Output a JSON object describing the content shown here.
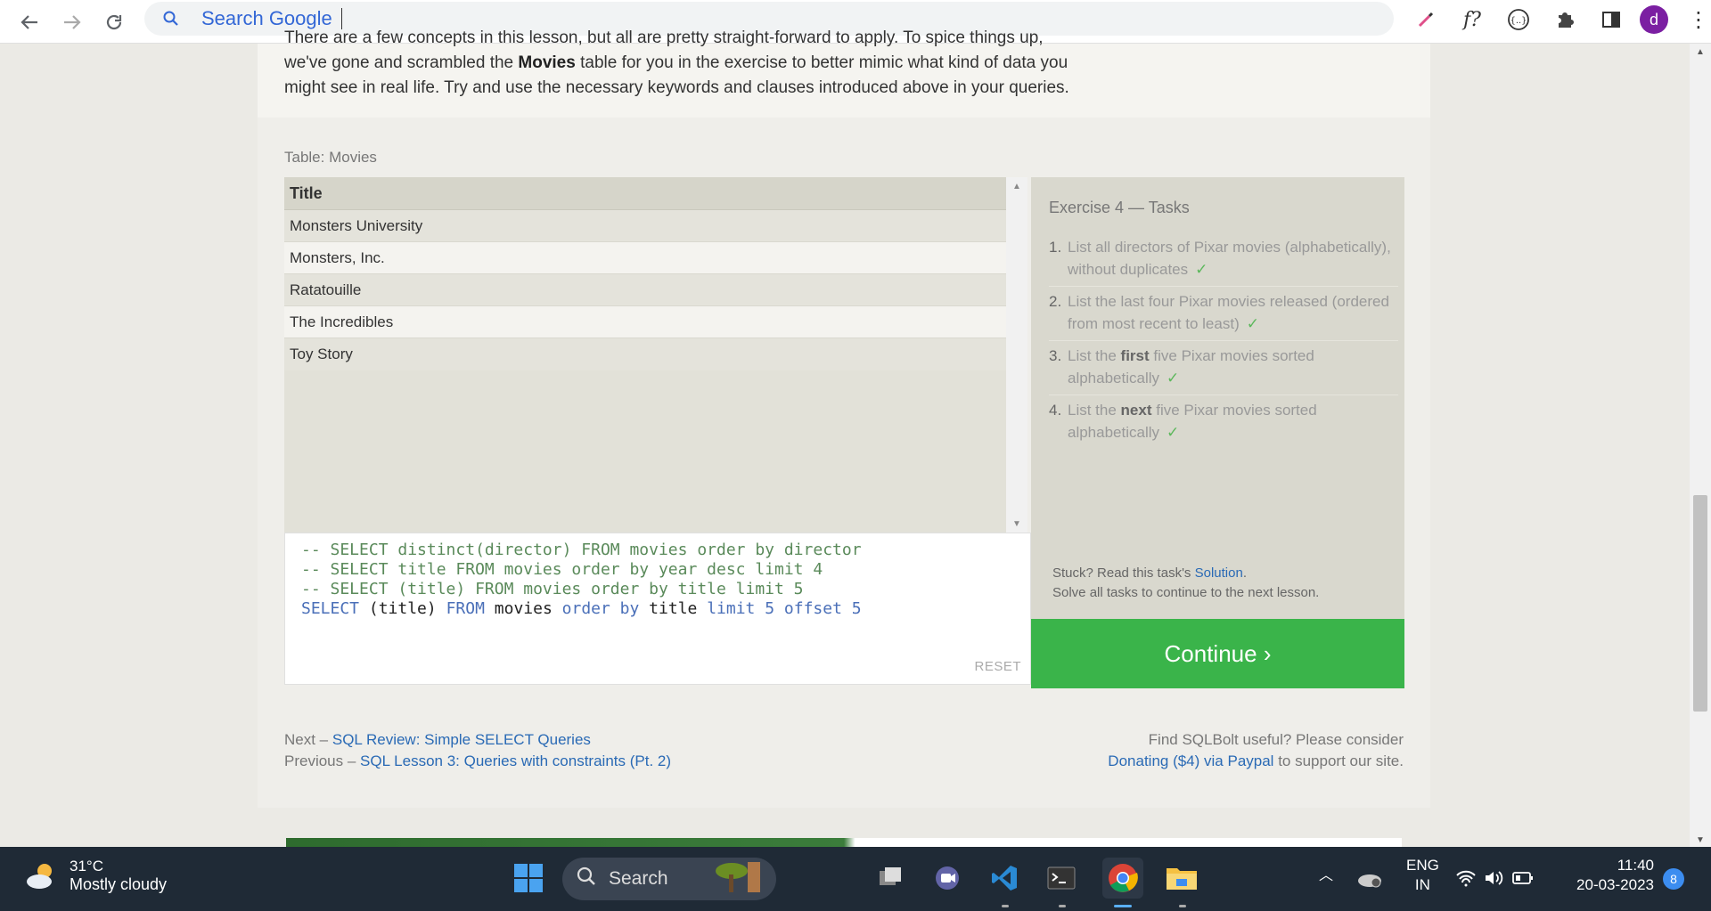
{
  "browser": {
    "omnibox_text": "Search Google",
    "avatar_letter": "d"
  },
  "intro": {
    "line0": "There are a few concepts in this lesson, but all are pretty straight-forward to apply. To spice things up,",
    "line1_pre": "we've gone and scrambled the ",
    "line1_bold": "Movies",
    "line1_post": " table for you in the exercise to better mimic what kind of data you",
    "line2": "might see in real life. Try and use the necessary keywords and clauses introduced above in your queries."
  },
  "table": {
    "label": "Table: Movies",
    "header": "Title",
    "rows": [
      "Monsters University",
      "Monsters, Inc.",
      "Ratatouille",
      "The Incredibles",
      "Toy Story"
    ]
  },
  "editor": {
    "comment1": "-- SELECT distinct(director) FROM movies order by director",
    "comment2": "-- SELECT title FROM movies order by year desc limit 4",
    "comment3": "-- SELECT (title) FROM movies order by title limit 5",
    "active": {
      "kw_select": "SELECT",
      "t_title": " (title) ",
      "kw_from": "FROM",
      "t_movies": " movies ",
      "kw_order": "order by",
      "t_title2": " title ",
      "kw_limit": "limit",
      "n5": " 5 ",
      "kw_offset": "offset",
      "n5b": " 5"
    },
    "reset_label": "RESET"
  },
  "tasks": {
    "heading": "Exercise 4 — Tasks",
    "items": [
      {
        "num": "1.",
        "pre": "List all directors of Pixar movies (alphabetically), without duplicates",
        "bold": "",
        "post": "",
        "check": "✓"
      },
      {
        "num": "2.",
        "pre": "List the last four Pixar movies released (ordered from most recent to least)",
        "bold": "",
        "post": "",
        "check": "✓"
      },
      {
        "num": "3.",
        "pre": "List the ",
        "bold": "first",
        "post": " five Pixar movies sorted alphabetically",
        "check": "✓"
      },
      {
        "num": "4.",
        "pre": "List the ",
        "bold": "next",
        "post": " five Pixar movies sorted alphabetically",
        "check": "✓"
      }
    ],
    "stuck_pre": "Stuck? Read this task's ",
    "stuck_link": "Solution",
    "stuck_post": ".",
    "solve_all": "Solve all tasks to continue to the next lesson."
  },
  "continue_label": "Continue ›",
  "footer": {
    "next_pre": "Next – ",
    "next_link": "SQL Review: Simple SELECT Queries",
    "prev_pre": "Previous – ",
    "prev_link": "SQL Lesson 3: Queries with constraints (Pt. 2)",
    "useful": "Find SQLBolt useful? Please consider",
    "donate_link": "Donating ($4) via Paypal",
    "donate_post": " to support our site."
  },
  "taskbar": {
    "temp": "31°C",
    "weather": "Mostly cloudy",
    "search_label": "Search",
    "lang1": "ENG",
    "lang2": "IN",
    "time": "11:40",
    "date": "20-03-2023",
    "badge": "8"
  },
  "colors": {
    "continue_bg": "#3ab44a",
    "link": "#2a6ab5",
    "check": "#5cb85c"
  }
}
